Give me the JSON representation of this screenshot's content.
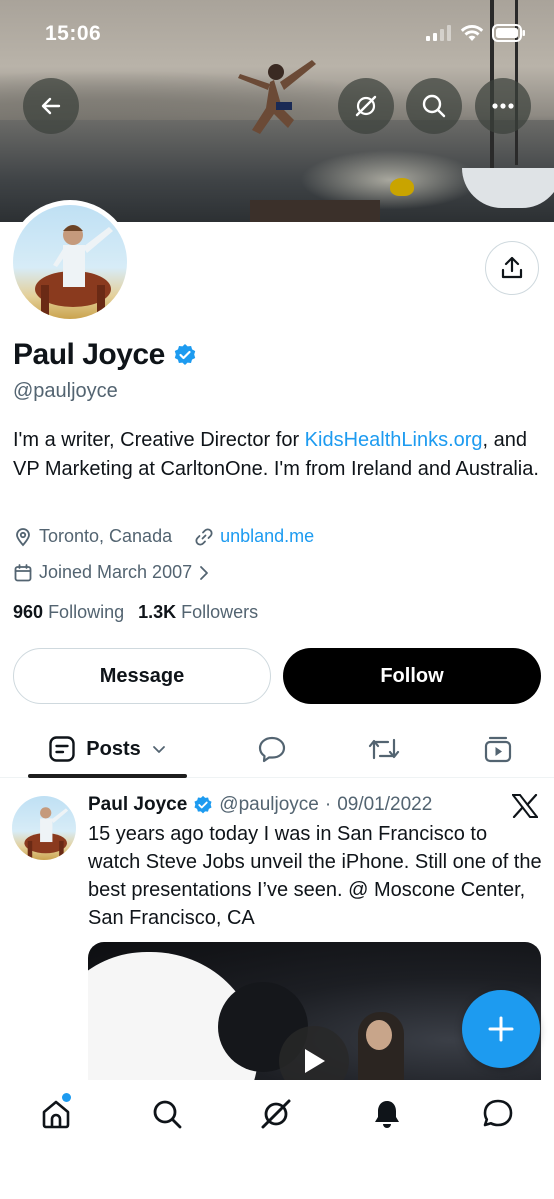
{
  "status_bar": {
    "time": "15:06"
  },
  "profile": {
    "name": "Paul Joyce",
    "handle": "@pauljoyce",
    "bio_part1": "I'm a writer, Creative Director for ",
    "bio_link": "KidsHealthLinks.org",
    "bio_part2": ", and VP Marketing at CarltonOne. I'm from Ireland and Australia.",
    "location": "Toronto, Canada",
    "website": "unbland.me",
    "joined": "Joined March 2007",
    "following_count": "960",
    "following_label": "Following",
    "followers_count": "1.3K",
    "followers_label": "Followers",
    "verified": true
  },
  "actions": {
    "message_label": "Message",
    "follow_label": "Follow"
  },
  "tabs": {
    "posts_label": "Posts"
  },
  "post": {
    "author": "Paul Joyce",
    "handle": "@pauljoyce",
    "separator": "·",
    "date": "09/01/2022",
    "source_icon": "x-logo",
    "text": "15 years ago today I was in San Francisco to watch Steve Jobs unveil the iPhone. Still one of the best presentations I’ve seen. @ Moscone Center, San Francisco, CA"
  },
  "colors": {
    "accent": "#1d9bf0",
    "text": "#0f1419",
    "secondary": "#536471",
    "follow_bg": "#000000"
  },
  "icons": {
    "back": "back-arrow-icon",
    "grok": "grok-icon",
    "search": "search-icon",
    "more": "more-icon",
    "share": "share-icon",
    "location": "location-pin-icon",
    "link": "link-icon",
    "calendar": "calendar-icon",
    "replies": "replies-tab-icon",
    "reposts": "reposts-tab-icon",
    "media": "media-tab-icon",
    "compose": "compose-plus-icon",
    "home": "home-icon",
    "notifications": "bell-icon",
    "messages": "messages-icon"
  }
}
